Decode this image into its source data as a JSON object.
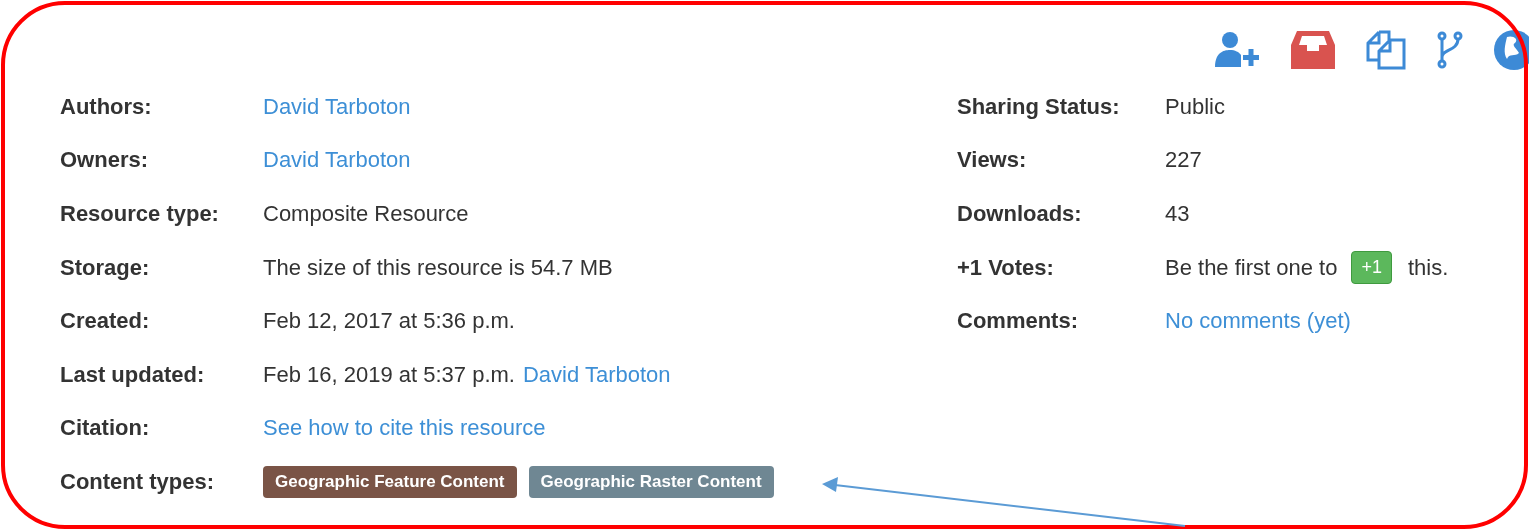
{
  "left_fields": [
    {
      "label": "Authors:",
      "value": [
        {
          "kind": "link",
          "text": "David Tarboton"
        }
      ]
    },
    {
      "label": "Owners:",
      "value": [
        {
          "kind": "link",
          "text": "David Tarboton"
        }
      ]
    },
    {
      "label": "Resource type:",
      "value": [
        {
          "kind": "text",
          "text": "Composite Resource"
        }
      ]
    },
    {
      "label": "Storage:",
      "value": [
        {
          "kind": "text",
          "text": "The size of this resource is 54.7 MB"
        }
      ]
    },
    {
      "label": "Created:",
      "value": [
        {
          "kind": "text",
          "text": "Feb 12, 2017 at 5:36 p.m."
        }
      ]
    },
    {
      "label": "Last updated:",
      "value": [
        {
          "kind": "text",
          "text": "Feb 16, 2019 at 5:37 p.m."
        },
        {
          "kind": "link",
          "text": "David Tarboton"
        }
      ]
    },
    {
      "label": "Citation:",
      "value": [
        {
          "kind": "link",
          "text": "See how to cite this resource"
        }
      ]
    },
    {
      "label": "Content types:",
      "value": [
        {
          "kind": "tag",
          "text": "Geographic Feature Content",
          "color": "#7a5446"
        },
        {
          "kind": "tag",
          "text": "Geographic Raster Content",
          "color": "#6f8793"
        }
      ]
    }
  ],
  "right_fields": [
    {
      "label": "Sharing Status:",
      "value": [
        {
          "kind": "text",
          "text": "Public"
        }
      ]
    },
    {
      "label": "Views:",
      "value": [
        {
          "kind": "text",
          "text": "227"
        }
      ]
    },
    {
      "label": "Downloads:",
      "value": [
        {
          "kind": "text",
          "text": "43"
        }
      ]
    },
    {
      "label": "+1 Votes:",
      "value": [
        {
          "kind": "text",
          "text": "Be the first one to"
        },
        {
          "kind": "button",
          "text": "+1"
        },
        {
          "kind": "text",
          "text": "this."
        }
      ]
    },
    {
      "label": "Comments:",
      "value": [
        {
          "kind": "link",
          "text": "No comments (yet)"
        }
      ]
    }
  ]
}
